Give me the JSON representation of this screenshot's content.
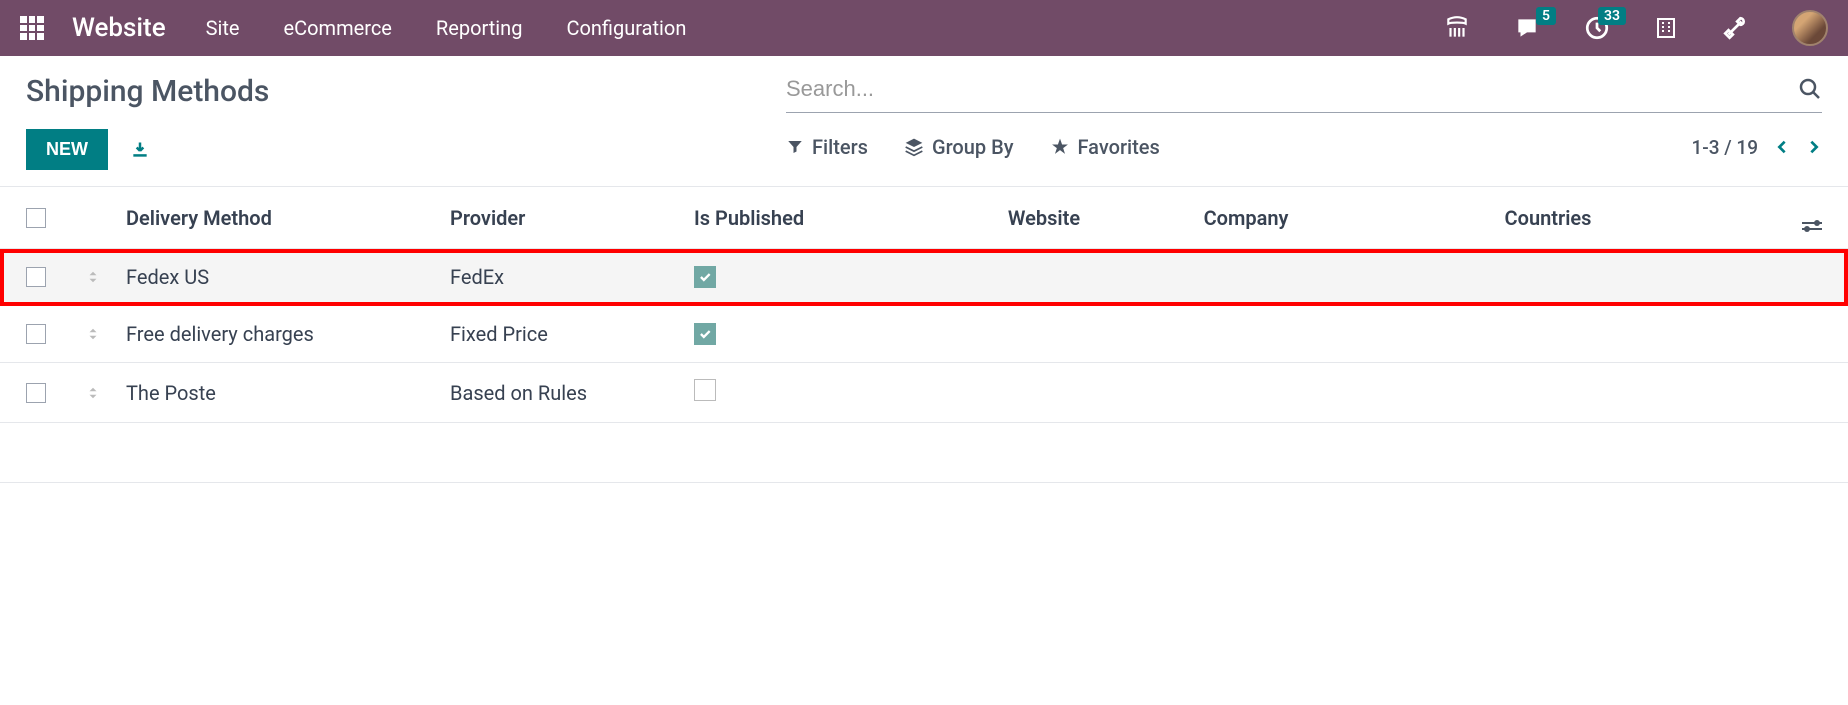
{
  "topbar": {
    "brand": "Website",
    "menu": [
      "Site",
      "eCommerce",
      "Reporting",
      "Configuration"
    ],
    "chat_badge": "5",
    "activity_badge": "33"
  },
  "page": {
    "title": "Shipping Methods",
    "new_label": "NEW",
    "search_placeholder": "Search..."
  },
  "filters": {
    "filters": "Filters",
    "groupby": "Group By",
    "favorites": "Favorites",
    "pager": "1-3 / 19"
  },
  "table": {
    "headers": {
      "delivery": "Delivery Method",
      "provider": "Provider",
      "published": "Is Published",
      "website": "Website",
      "company": "Company",
      "countries": "Countries"
    },
    "rows": [
      {
        "delivery": "Fedex US",
        "provider": "FedEx",
        "published": true,
        "highlighted": true
      },
      {
        "delivery": "Free delivery charges",
        "provider": "Fixed Price",
        "published": true,
        "highlighted": false
      },
      {
        "delivery": "The Poste",
        "provider": "Based on Rules",
        "published": false,
        "highlighted": false
      }
    ]
  }
}
